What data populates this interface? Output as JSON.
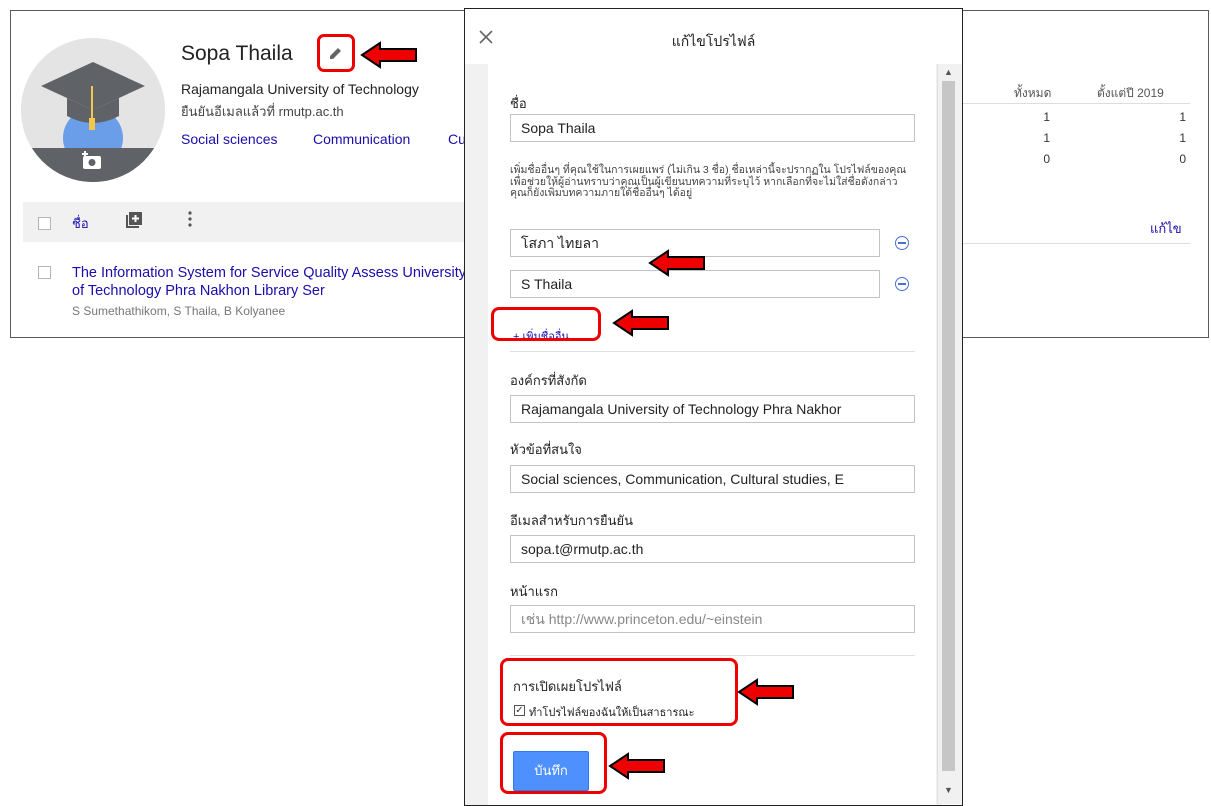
{
  "profile": {
    "name": "Sopa Thaila",
    "affiliation": "Rajamangala University of Technology",
    "verified_email": "ยืนยันอีเมลแล้วที่ rmutp.ac.th",
    "interests": [
      "Social sciences",
      "Communication",
      "Cu"
    ]
  },
  "stats": {
    "col_total": "ทั้งหมด",
    "col_since": "ตั้งแต่ปี 2019",
    "rows": [
      [
        "1",
        "1"
      ],
      [
        "1",
        "1"
      ],
      [
        "0",
        "0"
      ]
    ],
    "edit_link": "แก้ไข"
  },
  "list": {
    "col_name": "ชื่อ",
    "article_title": "The Information System for Service Quality Assess University of Technology Phra Nakhon Library Ser",
    "article_authors": "S Sumethathikom, S Thaila, B Kolyanee"
  },
  "dialog": {
    "title": "แก้ไขโปรไฟล์",
    "name_label": "ชื่อ",
    "name_value": "Sopa Thaila",
    "help_text": "เพิ่มชื่ออื่นๆ ที่คุณใช้ในการเผยแพร่ (ไม่เกิน 3 ชื่อ) ชื่อเหล่านี้จะปรากฏใน โปรไฟล์ของคุณเพื่อช่วยให้ผู้อ่านทราบว่าคุณเป็นผู้เขียนบทความที่ระบุไว้ หากเลือกที่จะไม่ใส่ชื่อดังกล่าว คุณก็ยังเพิ่มบทความภายใต้ชื่ออื่นๆ ได้อยู่",
    "other_names": [
      "โสภา ไทยลา",
      "S Thaila"
    ],
    "add_other_name": "+ เพิ่มชื่ออื่น",
    "affiliation_label": "องค์กรที่สังกัด",
    "affiliation_value": "Rajamangala University of Technology Phra Nakhor",
    "interests_label": "หัวข้อที่สนใจ",
    "interests_value": "Social sciences, Communication, Cultural studies, E",
    "email_label": "อีเมลสำหรับการยืนยัน",
    "email_value": "sopa.t@rmutp.ac.th",
    "homepage_label": "หน้าแรก",
    "homepage_placeholder": "เช่น http://www.princeton.edu/~einstein",
    "visibility_label": "การเปิดเผยโปรไฟล์",
    "visibility_checkbox_label": "ทำโปรไฟล์ของฉันให้เป็นสาธารณะ",
    "visibility_checked": true,
    "save_label": "บันทึก"
  },
  "colors": {
    "link": "#1a0dab",
    "primary_button": "#4d90fe",
    "annotation_red": "#e00000"
  }
}
